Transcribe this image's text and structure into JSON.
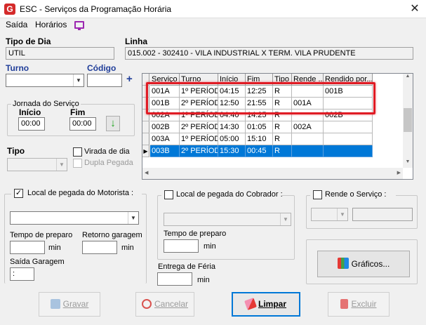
{
  "window": {
    "title": "ESC - Serviços da Programação Horária",
    "close_glyph": "✕",
    "icon_letter": "G"
  },
  "menu": {
    "items": [
      "Saída",
      "Horários"
    ]
  },
  "tipo_dia": {
    "label": "Tipo de Dia",
    "value": "UTIL"
  },
  "linha": {
    "label": "Linha",
    "value": "015.002 - 302410 - VILA INDUSTRIAL X TERM. VILA PRUDENTE"
  },
  "turno": {
    "label": "Turno"
  },
  "codigo": {
    "label": "Código",
    "add_glyph": "+"
  },
  "jornada": {
    "title": "Jornada do Serviço",
    "inicio_label": "Início",
    "inicio_value": "00:00",
    "fim_label": "Fim",
    "fim_value": "00:00",
    "down_glyph": "↓"
  },
  "tipo": {
    "label": "Tipo"
  },
  "virada_dia": {
    "label": "Virada de dia"
  },
  "dupla_pegada": {
    "label": "Dupla Pegada"
  },
  "grid": {
    "columns": [
      "Serviço",
      "Turno",
      "Início",
      "Fim",
      "Tipo",
      "Rende ...",
      "Rendido por..."
    ],
    "rows": [
      [
        "001A",
        "1º PERÍOD",
        "04:15",
        "12:25",
        "R",
        "",
        "001B"
      ],
      [
        "001B",
        "2º PERÍOD",
        "12:50",
        "21:55",
        "R",
        "001A",
        ""
      ],
      [
        "002A",
        "1º PERÍOD",
        "04:40",
        "14:25",
        "R",
        "",
        "002B"
      ],
      [
        "002B",
        "2º PERÍOD",
        "14:30",
        "01:05",
        "R",
        "002A",
        ""
      ],
      [
        "003A",
        "1º PERÍOD",
        "05:00",
        "15:10",
        "R",
        "",
        ""
      ],
      [
        "003B",
        "2º PERÍOD",
        "15:30",
        "00:45",
        "R",
        "",
        ""
      ]
    ],
    "selected_row": 5,
    "row_indicator_glyph": "▶",
    "scroll_left_glyph": "◀",
    "scroll_right_glyph": "▶",
    "scroll_up_glyph": "▲",
    "scroll_down_glyph": "▼"
  },
  "pegada_motorista": {
    "label": "Local de pegada do Motorista :",
    "checked": true,
    "check_glyph": "✓",
    "tempo_preparo_label": "Tempo de preparo",
    "retorno_label": "Retorno garagem",
    "min_unit": "min",
    "saida_label": "Saída Garagem",
    "saida_value": ":"
  },
  "pegada_cobrador": {
    "label": "Local de pegada do Cobrador :",
    "tempo_preparo_label": "Tempo de preparo",
    "min_unit": "min"
  },
  "entrega_feria": {
    "label": "Entrega de Féria",
    "min_unit": "min"
  },
  "rende_servico": {
    "label": "Rende o Serviço :"
  },
  "buttons": {
    "graficos": "Gráficos...",
    "gravar": "Gravar",
    "cancelar": "Cancelar",
    "limpar": "Limpar",
    "excluir": "Excluir"
  },
  "colors": {
    "selection": "#0078d7",
    "highlight": "#e01b24",
    "accent": "#9c27b0"
  }
}
